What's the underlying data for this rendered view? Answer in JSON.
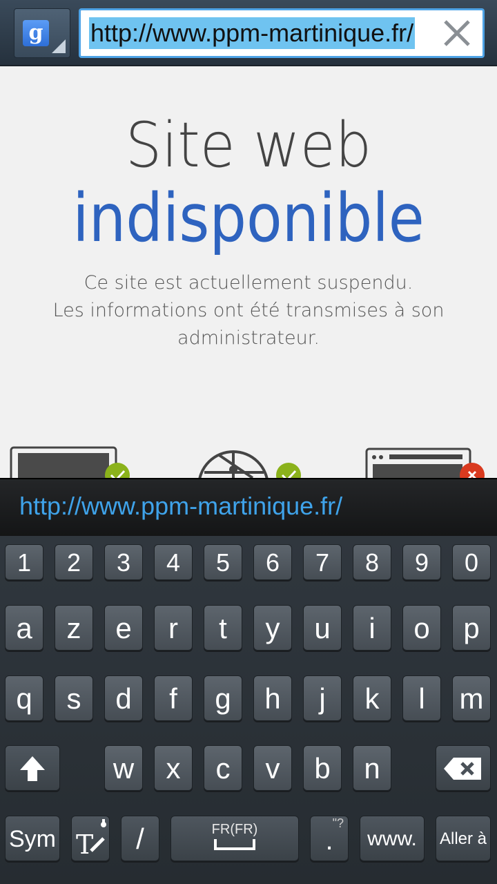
{
  "address_bar": {
    "search_engine_icon": "google-icon",
    "url": "http://www.ppm-martinique.fr/"
  },
  "page": {
    "headline_line1": "Site web",
    "headline_line2": "indisponible",
    "message_line1": "Ce site est actuellement suspendu.",
    "message_line2": "Les informations ont été transmises à son",
    "message_line3": "administrateur.",
    "accent_color": "#2e63bf",
    "status_icons": [
      "check-icon",
      "check-icon",
      "error-x-icon"
    ]
  },
  "suggestion": {
    "url": "http://www.ppm-martinique.fr/"
  },
  "keyboard": {
    "digits": [
      "1",
      "2",
      "3",
      "4",
      "5",
      "6",
      "7",
      "8",
      "9",
      "0"
    ],
    "row1": [
      "a",
      "z",
      "e",
      "r",
      "t",
      "y",
      "u",
      "i",
      "o",
      "p"
    ],
    "row2": [
      "q",
      "s",
      "d",
      "f",
      "g",
      "h",
      "j",
      "k",
      "l",
      "m"
    ],
    "row3": [
      "w",
      "x",
      "c",
      "v",
      "b",
      "n"
    ],
    "sym_label": "Sym",
    "slash_label": "/",
    "space_label": "FR(FR)",
    "period_label": ".",
    "period_hint": "\"?",
    "www_label": "www.",
    "go_label": "Aller à"
  }
}
